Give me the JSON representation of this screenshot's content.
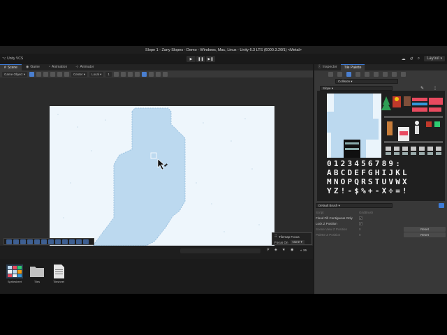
{
  "window": {
    "title": "Slope 1 - Zany Slopes - Demo - Windows, Mac, Linux - Unity 6.3 LTS (6000.3.20f1) <Metal>"
  },
  "toolbar": {
    "vcs_label": "Unity VCS",
    "layout_label": "Layout",
    "play_icon": "▶",
    "pause_icon": "❚❚",
    "step_icon": "▶❚"
  },
  "left_tabs": [
    {
      "label": "Scene",
      "icon": "grid-icon"
    },
    {
      "label": "Game",
      "icon": "gamepad-icon"
    },
    {
      "label": "Animation",
      "icon": "animation-icon"
    },
    {
      "label": "Animator",
      "icon": "animator-icon"
    }
  ],
  "scene_toolbar": {
    "game_object_label": "Game Object",
    "pivot_label": "Center",
    "space_label": "Local",
    "snap_value": "1"
  },
  "tilemap_focus": {
    "title": "Tilemap Focus",
    "focus_on_label": "Focus On",
    "focus_value": "None"
  },
  "project": {
    "count": "26",
    "assets": [
      {
        "name": "Spritesheet",
        "icon": "spritesheet-icon"
      },
      {
        "name": "Tiles",
        "icon": "folder-icon"
      },
      {
        "name": "Tilesheet",
        "icon": "document-icon"
      }
    ]
  },
  "right_tabs": [
    {
      "label": "Inspector"
    },
    {
      "label": "Tile Palette"
    }
  ],
  "tile_palette": {
    "active_tilemap": "Collision",
    "palette_name": "Slope",
    "glyph_rows": [
      "0123456789:",
      "ABCDEFGHIJKL",
      "MNOPQRSTUVWX",
      "YZ!-$%+-X÷=!"
    ]
  },
  "brush": {
    "name": "Default Brush",
    "script_label": "Script",
    "script_value": "GridBrush",
    "flood_fill_label": "Flood Fill Contiguous Only",
    "lock_z_label": "Lock Z Position",
    "scene_view_z_label": "Scene View Z Position",
    "scene_view_z_value": "0",
    "palette_z_label": "Palette Z Position",
    "palette_z_value": "0",
    "reset_label": "Reset",
    "check_mark": "✓"
  },
  "colors": {
    "accent": "#3d7bd6",
    "snow": "#bcd9ef",
    "sky": "#eef6fc"
  }
}
